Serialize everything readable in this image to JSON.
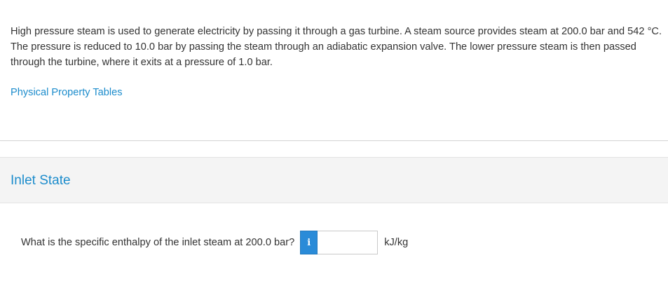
{
  "problem": {
    "text": "High pressure steam is used to generate electricity by passing it through a gas turbine.  A steam source provides steam at 200.0 bar and 542 °C.  The pressure is reduced to 10.0 bar by passing the steam through an adiabatic expansion valve.  The lower pressure steam is then passed through the turbine, where it exits at a pressure of 1.0 bar.",
    "link_label": "Physical Property Tables"
  },
  "section": {
    "title": "Inlet State"
  },
  "question": {
    "text": "What is the specific enthalpy of the inlet steam at 200.0 bar?",
    "info_icon": "info-icon",
    "info_glyph": "i",
    "answer_value": "",
    "unit": "kJ/kg"
  },
  "colors": {
    "link": "#1c8ccc",
    "info_button": "#2a8bd8",
    "section_bg": "#f4f4f4"
  }
}
